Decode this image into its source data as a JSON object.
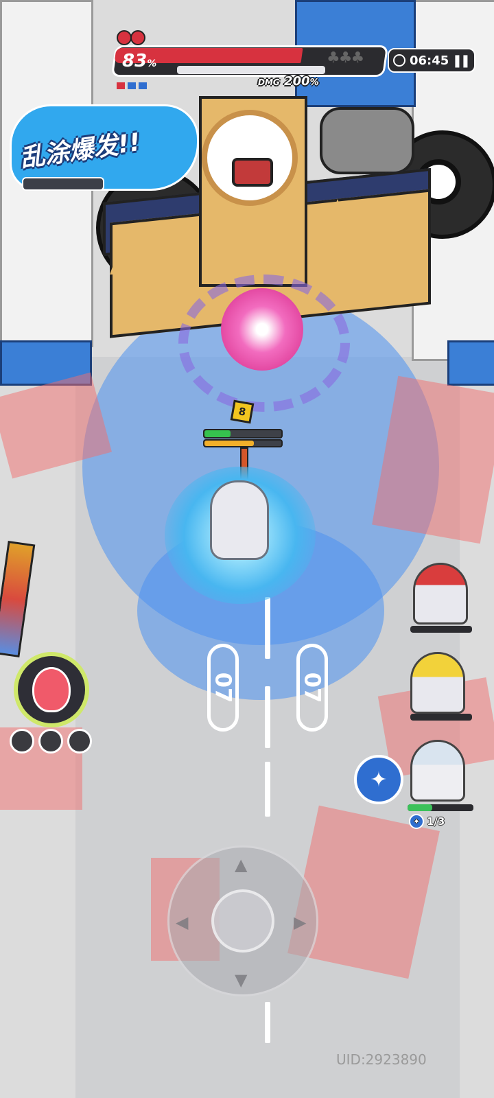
{
  "boss": {
    "hp_percent_value": "83",
    "hp_percent_symbol": "%",
    "hp_fraction": 0.83,
    "damage_label": "DMG",
    "damage_value": "200",
    "damage_symbol": "%"
  },
  "timer": {
    "time": "06:45"
  },
  "banner": {
    "text": "乱涂爆发!!"
  },
  "hero": {
    "level": "8"
  },
  "lanes": {
    "marker_text": "07"
  },
  "party": {
    "charges": "1/3"
  },
  "footer": {
    "uid": "UID:2923890"
  },
  "colors": {
    "boss_hp": "#d7323f",
    "hero_hp": "#36c24e",
    "hero_energy": "#f3b02a",
    "paint_blue": "#4d92f0",
    "paint_red": "#f26d6d",
    "skill_ring": "#cfe86a"
  },
  "icons": {
    "timer": "clock-icon",
    "pause": "pause-icon",
    "boss_extra": "clover-icon",
    "skill": "flame-icon",
    "ultimate": "butterfly-icon"
  }
}
